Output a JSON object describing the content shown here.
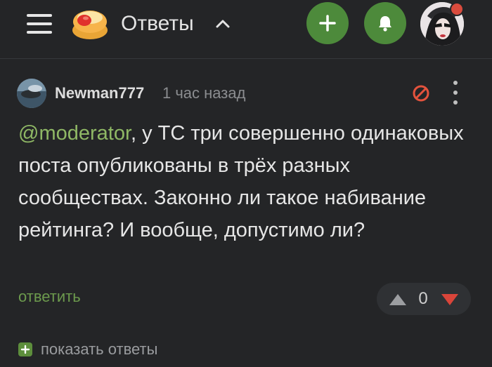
{
  "header": {
    "title": "Ответы",
    "icons": {
      "menu": "hamburger-icon",
      "logo": "pikabu-logo",
      "chevron": "chevron-up-icon",
      "add": "plus-icon",
      "notifications": "bell-icon"
    },
    "accent_color": "#4d8a3b"
  },
  "comment": {
    "author": "Newman777",
    "timestamp": "1 час назад",
    "mention": "@moderator",
    "text": ", у ТС три совершенно одинаковых поста опубликованы в трёх разных сообществах. Законно ли такое набивание рейтинга? И вообще, допустимо ли?",
    "reply_label": "ответить",
    "rating": "0",
    "icons": {
      "report": "ban-icon",
      "more": "more-vertical-icon",
      "upvote": "triangle-up-icon",
      "downvote": "triangle-down-icon"
    },
    "colors": {
      "mention": "#8fb865",
      "report": "#e4533d",
      "downvote": "#d9453a"
    }
  },
  "footer": {
    "show_replies_label": "показать ответы"
  }
}
